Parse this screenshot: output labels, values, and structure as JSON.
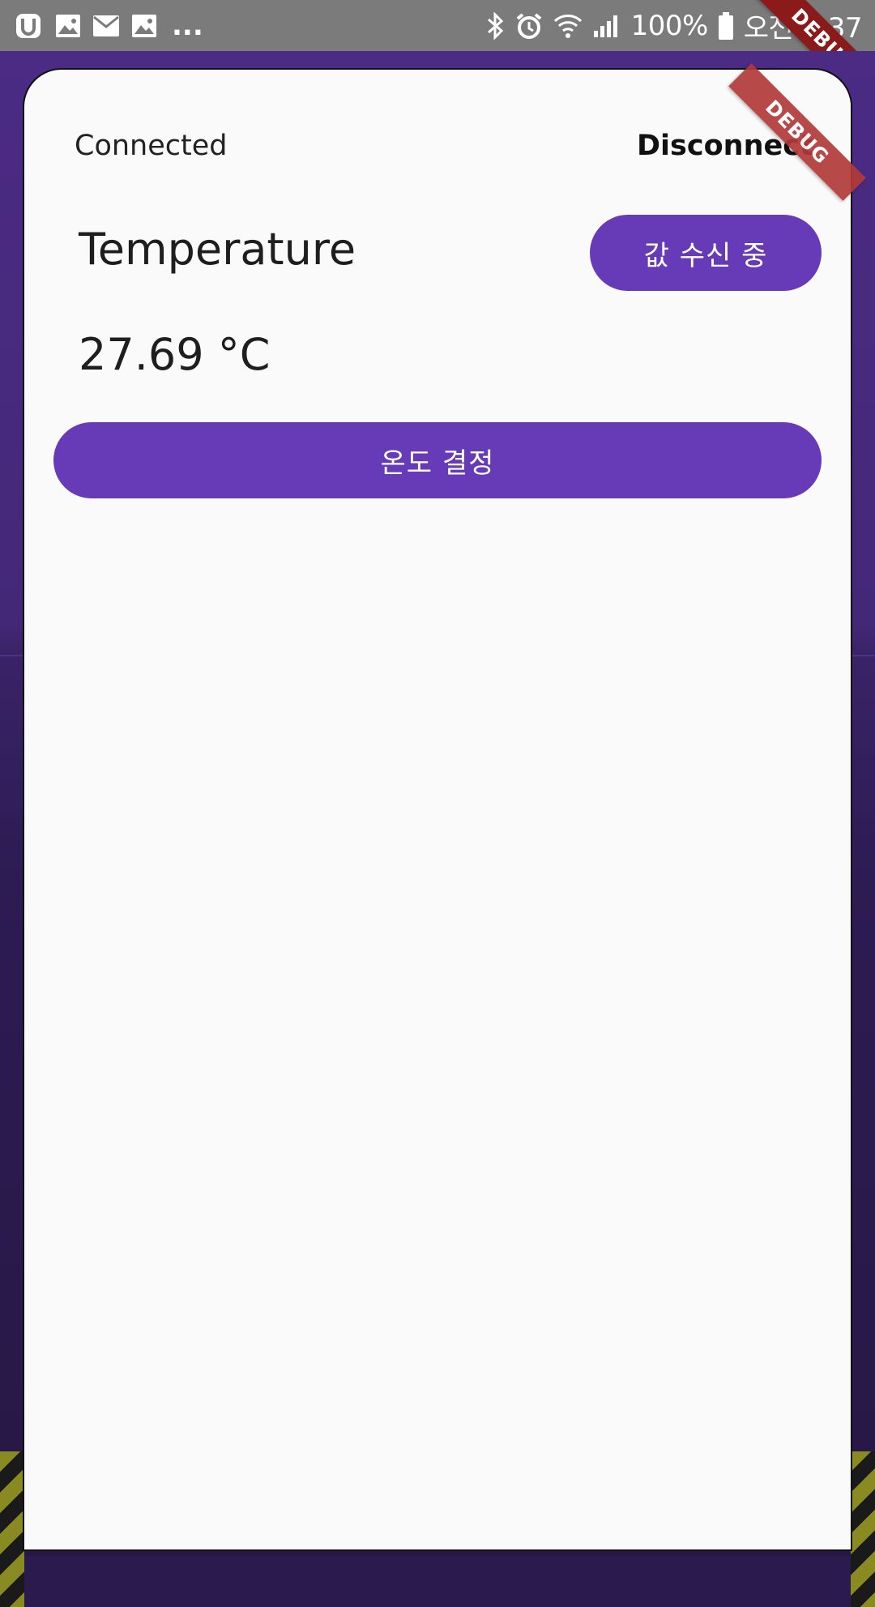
{
  "status_bar": {
    "battery_text": "100%",
    "time_text": "오전 7:37",
    "icons_left": [
      "app-icon",
      "image-icon",
      "mail-icon",
      "image-icon"
    ],
    "overflow": "...",
    "icons_right": [
      "bluetooth-icon",
      "alarm-icon",
      "wifi-icon",
      "signal-icon",
      "battery-icon"
    ]
  },
  "device": {
    "status_label": "Connected",
    "disconnect_label": "Disconnect"
  },
  "sensor": {
    "title": "Temperature",
    "value_text": "27.69 °C",
    "receiving_label": "값 수신 중"
  },
  "actions": {
    "set_temperature_label": "온도 결정"
  },
  "debug_banner": {
    "label": "DEBUG"
  },
  "colors": {
    "accent": "#673ab7",
    "status_bar": "#7b7b7b",
    "sheet": "#fafafa",
    "debug": "#a31515"
  }
}
